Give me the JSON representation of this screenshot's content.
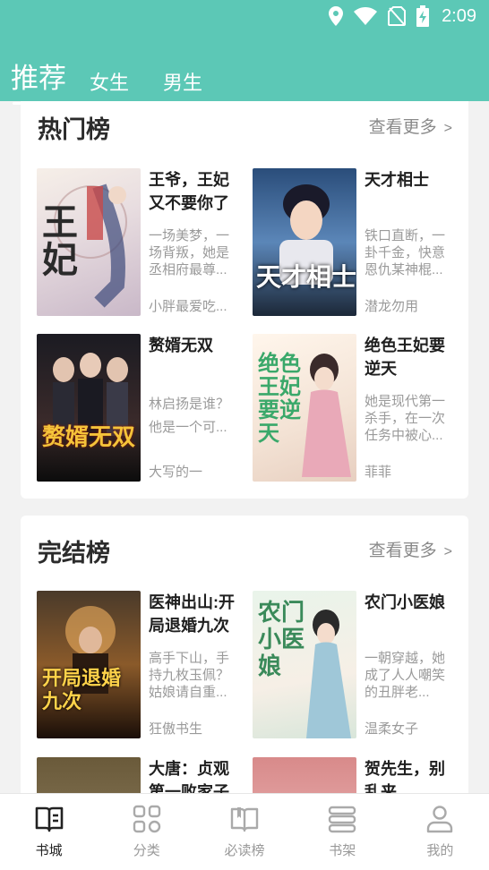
{
  "status": {
    "time": "2:09"
  },
  "tabs": [
    {
      "label": "推荐",
      "active": true
    },
    {
      "label": "女生",
      "active": false
    },
    {
      "label": "男生",
      "active": false
    }
  ],
  "sections": [
    {
      "title": "热门榜",
      "more": "查看更多",
      "books": [
        {
          "title": "王爷，王妃又不要你了",
          "desc": "一场美梦，一场背叛，她是丞相府最尊...",
          "author": "小胖最爱吃...",
          "cover_text": "王妃"
        },
        {
          "title": "天才相士",
          "desc": "铁口直断，一卦千金，快意恩仇某神棍...",
          "author": "潜龙勿用",
          "cover_text": "天才相士"
        },
        {
          "title": "赘婿无双",
          "desc": "林启扬是谁？\n他是一个可...",
          "author": "大写的一",
          "cover_text": "赘婿无双"
        },
        {
          "title": "绝色王妃要逆天",
          "desc": "她是现代第一杀手，在一次任务中被心...",
          "author": "菲菲",
          "cover_text": "绝色王妃要逆天"
        }
      ]
    },
    {
      "title": "完结榜",
      "more": "查看更多",
      "books": [
        {
          "title": "医神出山:开局退婚九次",
          "desc": "高手下山，手持九枚玉佩？姑娘请自重...",
          "author": "狂傲书生",
          "cover_text": "开局退婚九次"
        },
        {
          "title": "农门小医娘",
          "desc": "一朝穿越，她成了人人嘲笑的丑胖老...",
          "author": "温柔女子",
          "cover_text": "农门小医娘"
        },
        {
          "title": "大唐：贞观第一败家子",
          "desc": "",
          "author": "",
          "cover_text": ""
        },
        {
          "title": "贺先生，别乱来",
          "desc": "",
          "author": "",
          "cover_text": ""
        }
      ]
    }
  ],
  "bottom_nav": [
    {
      "label": "书城",
      "icon": "bookstore-icon",
      "active": true
    },
    {
      "label": "分类",
      "icon": "category-icon",
      "active": false
    },
    {
      "label": "必读榜",
      "icon": "must-read-icon",
      "active": false
    },
    {
      "label": "书架",
      "icon": "bookshelf-icon",
      "active": false
    },
    {
      "label": "我的",
      "icon": "profile-icon",
      "active": false
    }
  ],
  "colors": {
    "accent": "#5cc8b6",
    "text": "#222222",
    "muted": "#9a9a9a"
  }
}
